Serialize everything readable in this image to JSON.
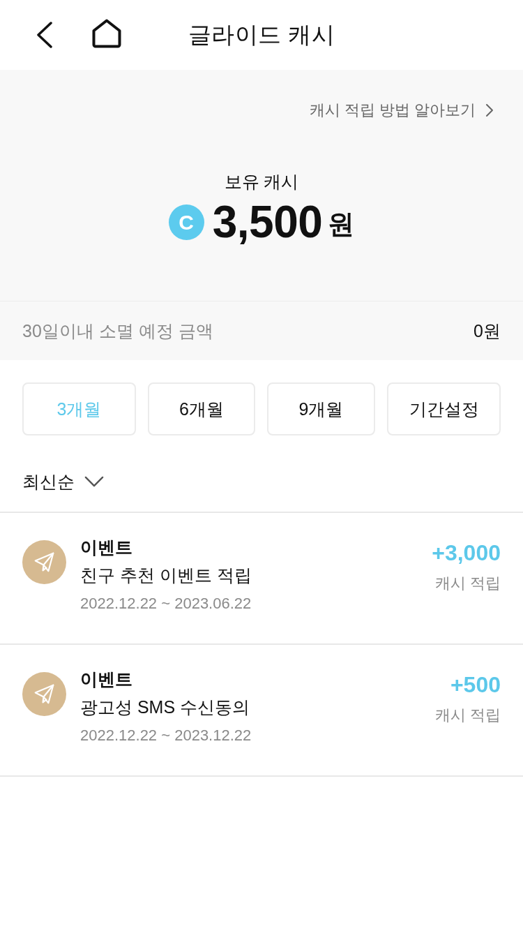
{
  "header": {
    "title": "글라이드 캐시"
  },
  "summary": {
    "guide_link": "캐시 적립 방법 알아보기",
    "balance_label": "보유 캐시",
    "coin_symbol": "C",
    "balance_amount": "3,500",
    "balance_unit": "원"
  },
  "expiry": {
    "label": "30일이내 소멸 예정 금액",
    "amount": "0원"
  },
  "period_tabs": [
    {
      "label": "3개월",
      "selected": true
    },
    {
      "label": "6개월",
      "selected": false
    },
    {
      "label": "9개월",
      "selected": false
    },
    {
      "label": "기간설정",
      "selected": false
    }
  ],
  "sort": {
    "label": "최신순"
  },
  "transactions": [
    {
      "category": "이벤트",
      "description": "친구 추천 이벤트 적립",
      "period": "2022.12.22 ~ 2023.06.22",
      "amount": "+3,000",
      "type": "캐시 적립"
    },
    {
      "category": "이벤트",
      "description": "광고성 SMS 수신동의",
      "period": "2022.12.22 ~ 2023.12.22",
      "amount": "+500",
      "type": "캐시 적립"
    }
  ]
}
